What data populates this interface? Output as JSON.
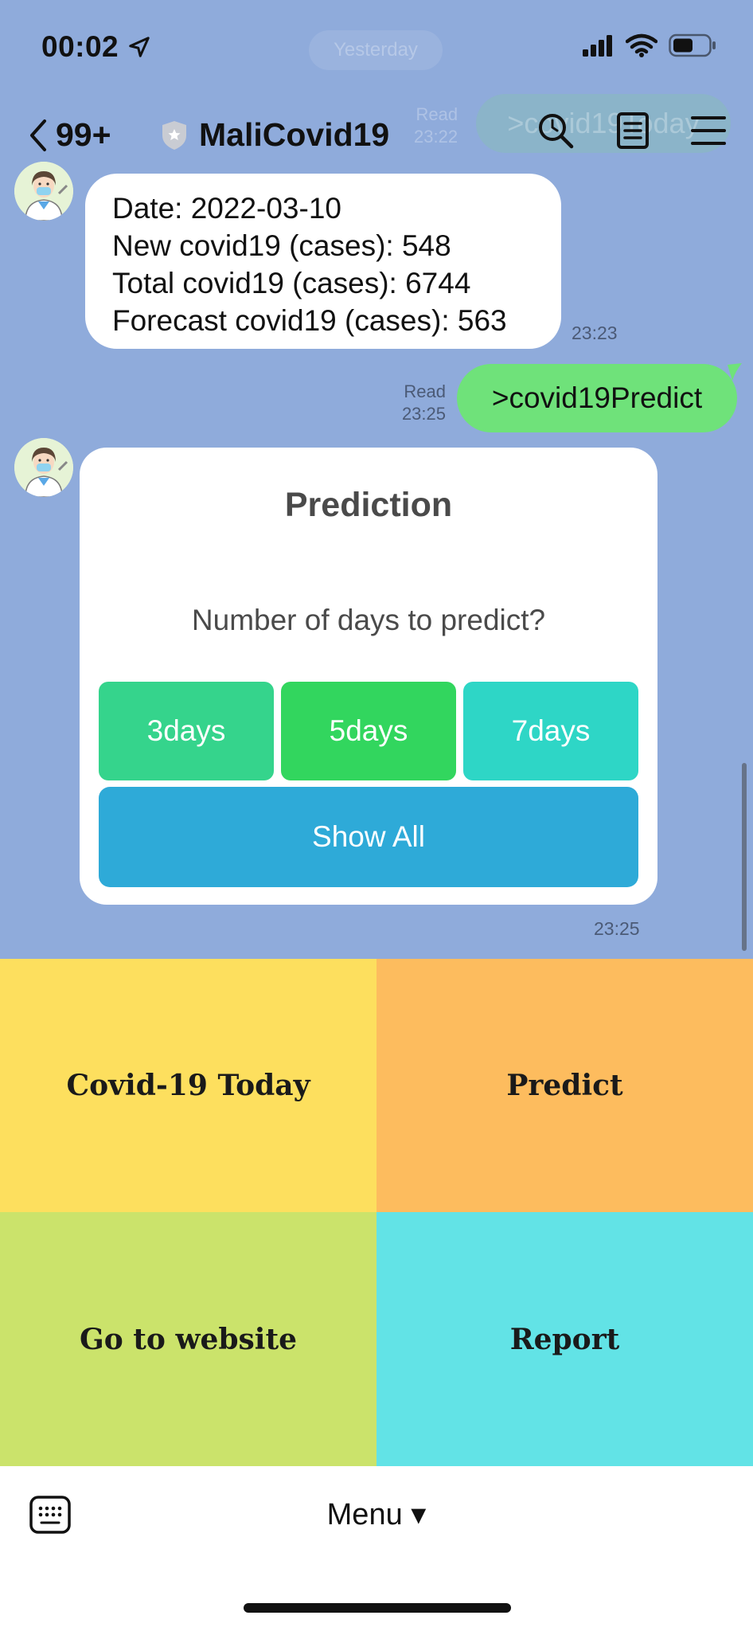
{
  "status": {
    "time": "00:02"
  },
  "background_ghost": {
    "date_divider": "Yesterday",
    "read_label": "Read",
    "read_time": "23:22",
    "ghost_message": ">covid19Today"
  },
  "header": {
    "back_count": "99+",
    "title": "MaliCovid19"
  },
  "messages": {
    "info": {
      "lines": [
        "Date: 2022-03-10",
        "New covid19 (cases): 548",
        "Total covid19 (cases): 6744",
        "Forecast covid19 (cases): 563"
      ],
      "time": "23:23"
    },
    "user": {
      "text": ">covid19Predict",
      "read_label": "Read",
      "time": "23:25"
    },
    "card": {
      "title": "Prediction",
      "question": "Number of days to predict?",
      "options": [
        {
          "label": "3days",
          "color": "#35d48c"
        },
        {
          "label": "5days",
          "color": "#32d65e"
        },
        {
          "label": "7days",
          "color": "#2ed6c6"
        }
      ],
      "show_all_label": "Show All",
      "show_all_color": "#2eaad8",
      "time": "23:25"
    }
  },
  "rich_menu": {
    "tiles": [
      {
        "label": "Covid-19 Today",
        "color": "#fddf5e"
      },
      {
        "label": "Predict",
        "color": "#fdbc5e"
      },
      {
        "label": "Go to website",
        "color": "#cbe36b"
      },
      {
        "label": "Report",
        "color": "#62e3e6"
      }
    ]
  },
  "bottom_bar": {
    "menu_label": "Menu ▾",
    "keyboard_icon": "keyboard-icon"
  }
}
